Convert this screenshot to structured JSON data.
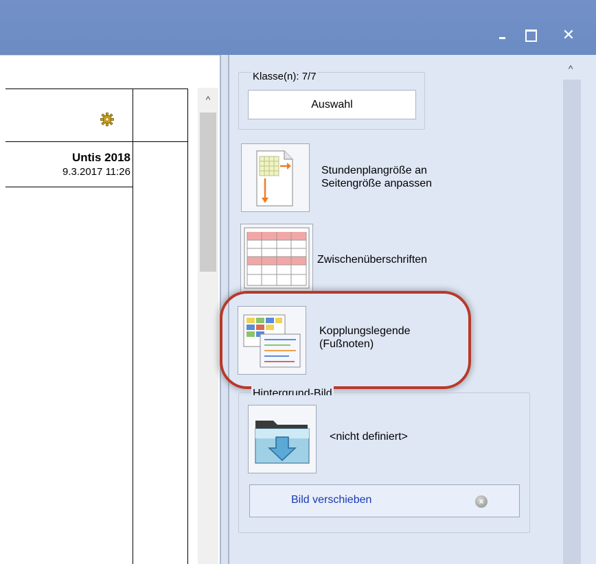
{
  "window": {
    "minimize_glyph": "",
    "maximize_glyph": "",
    "close_glyph": "✕"
  },
  "document": {
    "title": "Untis 2018",
    "date": "9.3.2017  11:26",
    "scroll_up_glyph": "^"
  },
  "panel": {
    "scroll_up_glyph": "^",
    "klasse_label": "Klasse(n): 7/7",
    "auswahl_button": "Auswahl",
    "fit_option": "Stundenplangröße an Seitengröße anpassen",
    "zwischen_option": "Zwischenüberschriften",
    "kopplung_option": "Kopplungslegende (Fußnoten)",
    "hintergrund_label": "Hintergrund-Bild",
    "bild_value": "<nicht definiert>",
    "verschieben_button": "Bild verschieben",
    "remove_glyph": "×"
  },
  "colors": {
    "titlebar": "#6b8bc3",
    "panel_bg": "#dfe7f5",
    "highlight": "#b8392a",
    "link_blue": "#1a39b0"
  }
}
